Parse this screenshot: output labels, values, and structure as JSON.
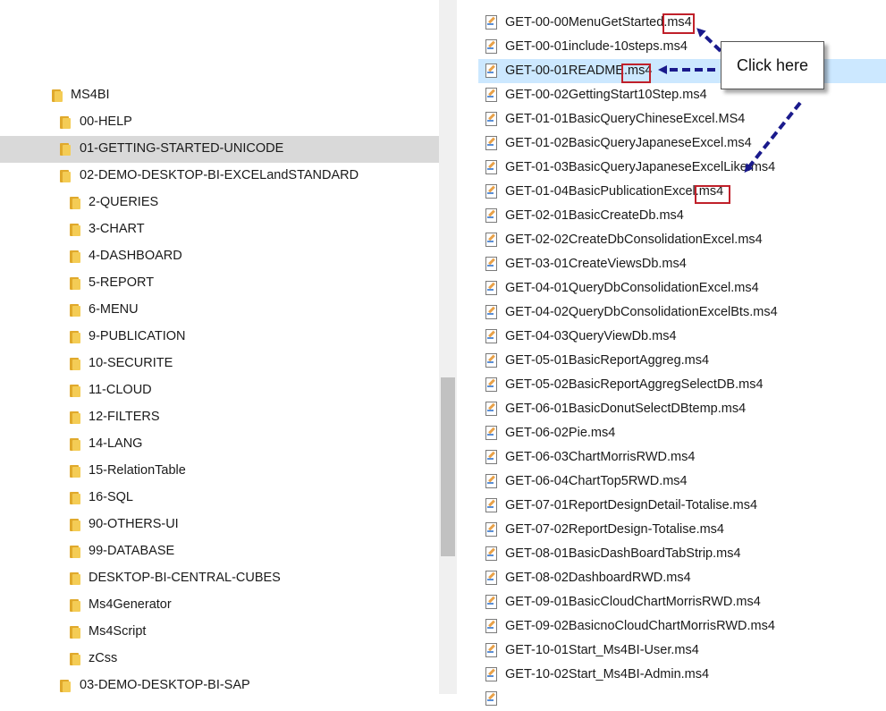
{
  "tree": {
    "items": [
      {
        "label": "MS4BI"
      },
      {
        "label": "00-HELP"
      },
      {
        "label": "01-GETTING-STARTED-UNICODE"
      },
      {
        "label": "02-DEMO-DESKTOP-BI-EXCELandSTANDARD"
      },
      {
        "label": "2-QUERIES"
      },
      {
        "label": "3-CHART"
      },
      {
        "label": "4-DASHBOARD"
      },
      {
        "label": "5-REPORT"
      },
      {
        "label": "6-MENU"
      },
      {
        "label": "9-PUBLICATION"
      },
      {
        "label": "10-SECURITE"
      },
      {
        "label": "11-CLOUD"
      },
      {
        "label": "12-FILTERS"
      },
      {
        "label": "14-LANG"
      },
      {
        "label": "15-RelationTable"
      },
      {
        "label": "16-SQL"
      },
      {
        "label": "90-OTHERS-UI"
      },
      {
        "label": "99-DATABASE"
      },
      {
        "label": "DESKTOP-BI-CENTRAL-CUBES"
      },
      {
        "label": "Ms4Generator"
      },
      {
        "label": "Ms4Script"
      },
      {
        "label": "zCss"
      },
      {
        "label": "03-DEMO-DESKTOP-BI-SAP"
      }
    ]
  },
  "files": {
    "items": [
      {
        "name": "GET-00-00MenuGetStarted.ms4"
      },
      {
        "name": "GET-00-01include-10steps.ms4"
      },
      {
        "name": "GET-00-01README.ms4"
      },
      {
        "name": "GET-00-02GettingStart10Step.ms4"
      },
      {
        "name": "GET-01-01BasicQueryChineseExcel.MS4"
      },
      {
        "name": "GET-01-02BasicQueryJapaneseExcel.ms4"
      },
      {
        "name": "GET-01-03BasicQueryJapaneseExcelLike.ms4"
      },
      {
        "name": "GET-01-04BasicPublicationExcel.ms4"
      },
      {
        "name": "GET-02-01BasicCreateDb.ms4"
      },
      {
        "name": "GET-02-02CreateDbConsolidationExcel.ms4"
      },
      {
        "name": "GET-03-01CreateViewsDb.ms4"
      },
      {
        "name": "GET-04-01QueryDbConsolidationExcel.ms4"
      },
      {
        "name": "GET-04-02QueryDbConsolidationExcelBts.ms4"
      },
      {
        "name": "GET-04-03QueryViewDb.ms4"
      },
      {
        "name": "GET-05-01BasicReportAggreg.ms4"
      },
      {
        "name": "GET-05-02BasicReportAggregSelectDB.ms4"
      },
      {
        "name": "GET-06-01BasicDonutSelectDBtemp.ms4"
      },
      {
        "name": "GET-06-02Pie.ms4"
      },
      {
        "name": "GET-06-03ChartMorrisRWD.ms4"
      },
      {
        "name": "GET-06-04ChartTop5RWD.ms4"
      },
      {
        "name": "GET-07-01ReportDesignDetail-Totalise.ms4"
      },
      {
        "name": "GET-07-02ReportDesign-Totalise.ms4"
      },
      {
        "name": "GET-08-01BasicDashBoardTabStrip.ms4"
      },
      {
        "name": "GET-08-02DashboardRWD.ms4"
      },
      {
        "name": "GET-09-01BasicCloudChartMorrisRWD.ms4"
      },
      {
        "name": "GET-09-02BasicnoCloudChartMorrisRWD.ms4"
      },
      {
        "name": "GET-10-01Start_Ms4BI-User.ms4"
      },
      {
        "name": "GET-10-02Start_Ms4BI-Admin.ms4"
      }
    ]
  },
  "callout": {
    "text": "Click here"
  },
  "colors": {
    "selection_tree": "#d9d9d9",
    "selection_file": "#cce8ff",
    "highlight_box": "#c0202a",
    "arrow": "#1a1a8c"
  }
}
